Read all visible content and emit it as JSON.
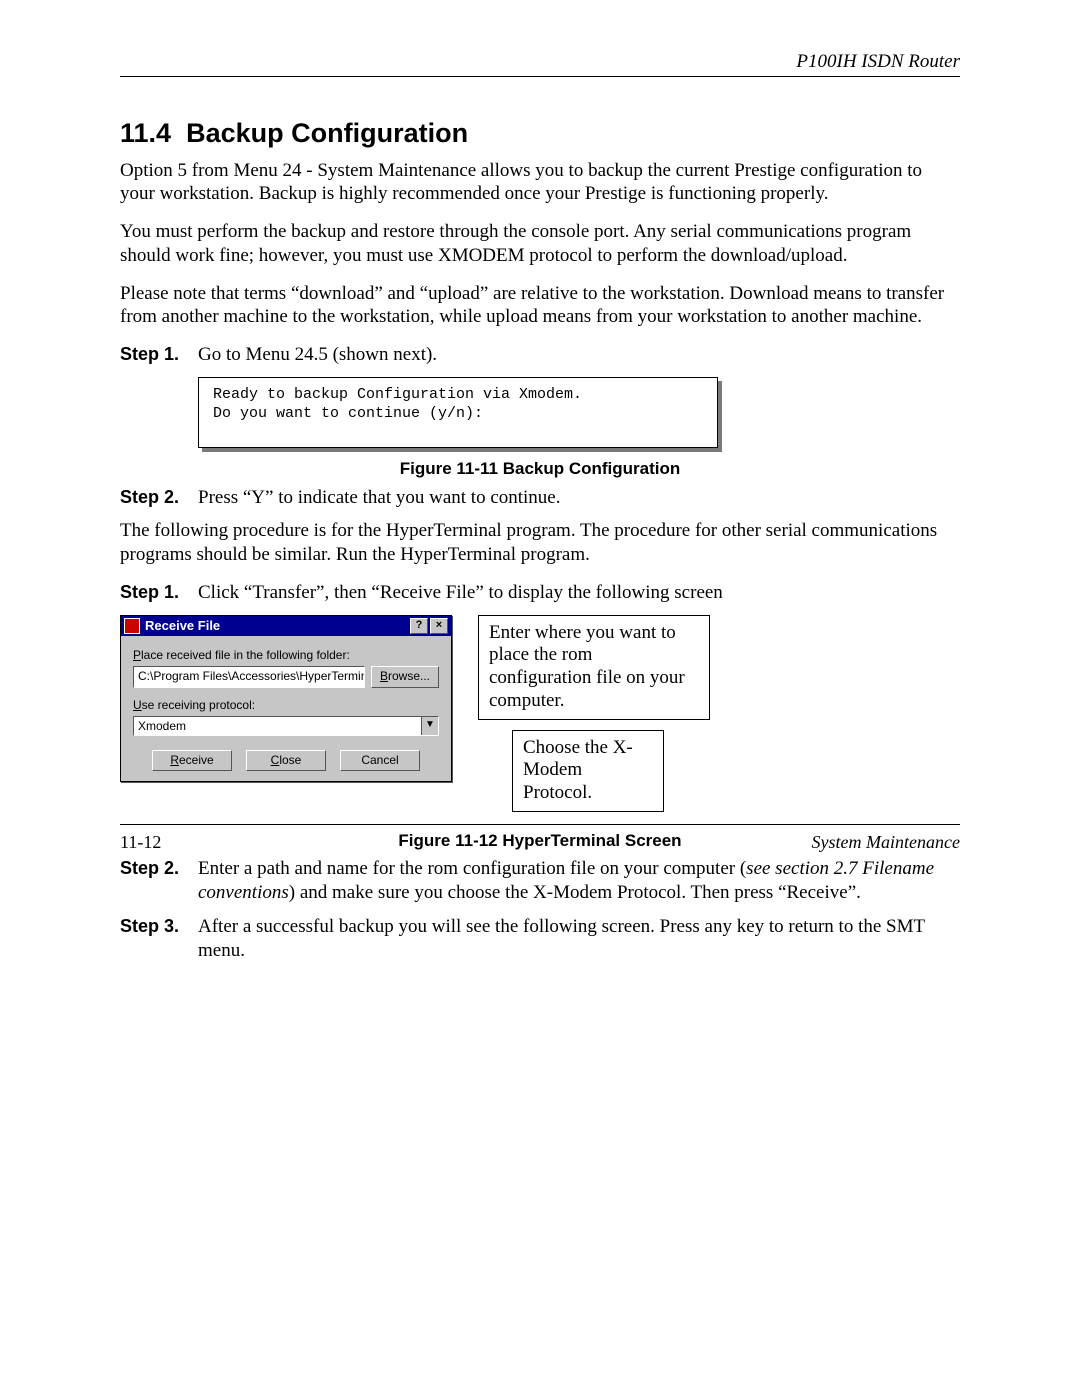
{
  "header": {
    "running": "P100IH ISDN Router"
  },
  "section": {
    "number": "11.4",
    "title": "Backup Configuration"
  },
  "para1": "Option 5 from Menu 24 - System Maintenance allows you to backup the current Prestige configuration to your workstation. Backup is highly recommended once your Prestige is functioning properly.",
  "para2": "You must perform the backup and restore through the console port. Any serial communications program should work fine; however, you must use XMODEM protocol to perform the download/upload.",
  "para3": "Please note that terms “download” and “upload” are relative to the workstation. Download means to transfer from another machine to the workstation, while upload means from your workstation to another machine.",
  "stepsA": [
    {
      "label": "Step 1.",
      "text": "Go to Menu 24.5 (shown next)."
    }
  ],
  "terminal": {
    "line1": "Ready to backup Configuration via Xmodem.",
    "line2": "Do you want to continue (y/n):"
  },
  "fig11": "Figure 11-11  Backup Configuration",
  "stepsB": [
    {
      "label": "Step 2.",
      "text": "Press “Y” to indicate that you want to continue."
    }
  ],
  "para4": "The following procedure is for the HyperTerminal program. The procedure for other serial communications programs should be similar. Run the HyperTerminal program.",
  "stepsC": [
    {
      "label": "Step 1.",
      "text": "Click “Transfer”, then “Receive File” to display the following screen"
    }
  ],
  "dialog": {
    "title": "Receive File",
    "help_btn": "?",
    "close_btn": "×",
    "label_folder_u": "P",
    "label_folder_rest": "lace received file in the following folder:",
    "folder_value": "C:\\Program Files\\Accessories\\HyperTerminal",
    "browse_u": "B",
    "browse_rest": "rowse...",
    "label_proto_u": "U",
    "label_proto_rest": "se receiving protocol:",
    "protocol_value": "Xmodem",
    "btn_receive_u": "R",
    "btn_receive_rest": "eceive",
    "btn_close_u": "C",
    "btn_close_rest": "lose",
    "btn_cancel": "Cancel"
  },
  "callouts": {
    "c1": "Enter where you want to place the rom configuration file on your computer.",
    "c2": "Choose the X-Modem Protocol."
  },
  "fig12": "Figure 11-12  HyperTerminal Screen",
  "stepsD": [
    {
      "label": "Step 2.",
      "pre": "Enter a path and name for the rom configuration file on your computer (",
      "xref": "see section 2.7 Filename conventions",
      "post": ") and make sure you choose the X-Modem Protocol. Then press “Receive”."
    },
    {
      "label": "Step 3.",
      "text": "After a successful backup you will see the following screen. Press any key to return to the SMT menu."
    }
  ],
  "footer": {
    "left": "11-12",
    "right": "System Maintenance"
  }
}
